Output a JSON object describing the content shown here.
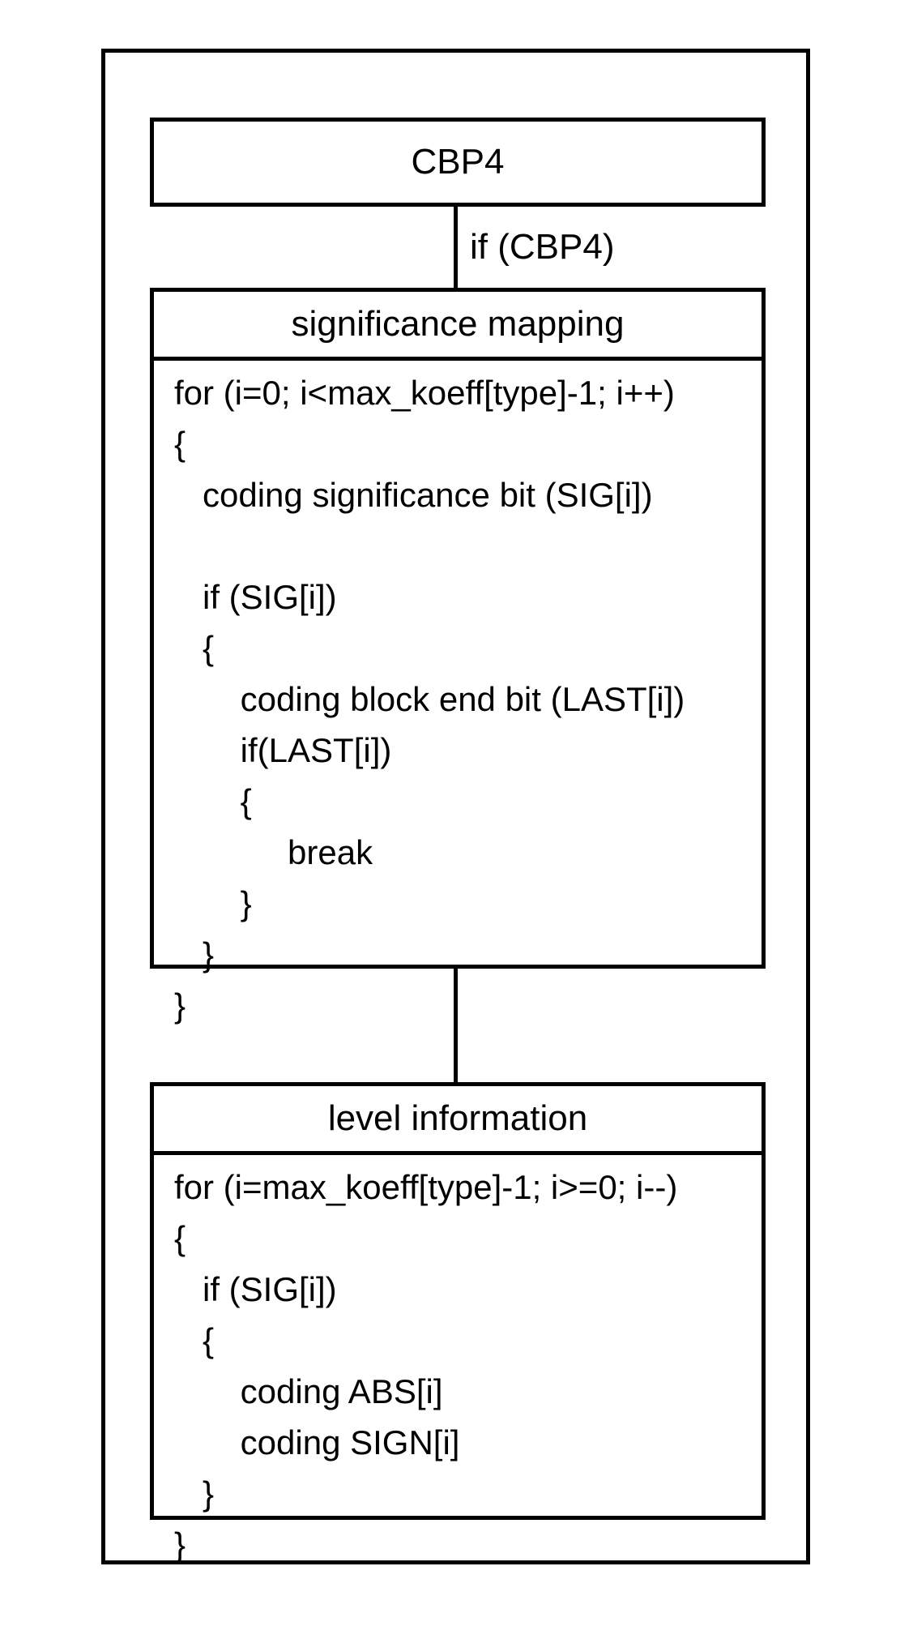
{
  "cbp4_label": "CBP4",
  "if_cbp4_label": "if (CBP4)",
  "sig_header": "significance mapping",
  "sig_body": "for (i=0; i<max_koeff[type]-1; i++)\n{\n   coding significance bit (SIG[i])\n\n   if (SIG[i])\n   {\n       coding block end bit (LAST[i])\n       if(LAST[i])\n       {\n            break\n       }\n   }\n}",
  "level_header": "level information",
  "level_body": "for (i=max_koeff[type]-1; i>=0; i--)\n{\n   if (SIG[i])\n   {\n       coding ABS[i]\n       coding SIGN[i]\n   }\n}"
}
